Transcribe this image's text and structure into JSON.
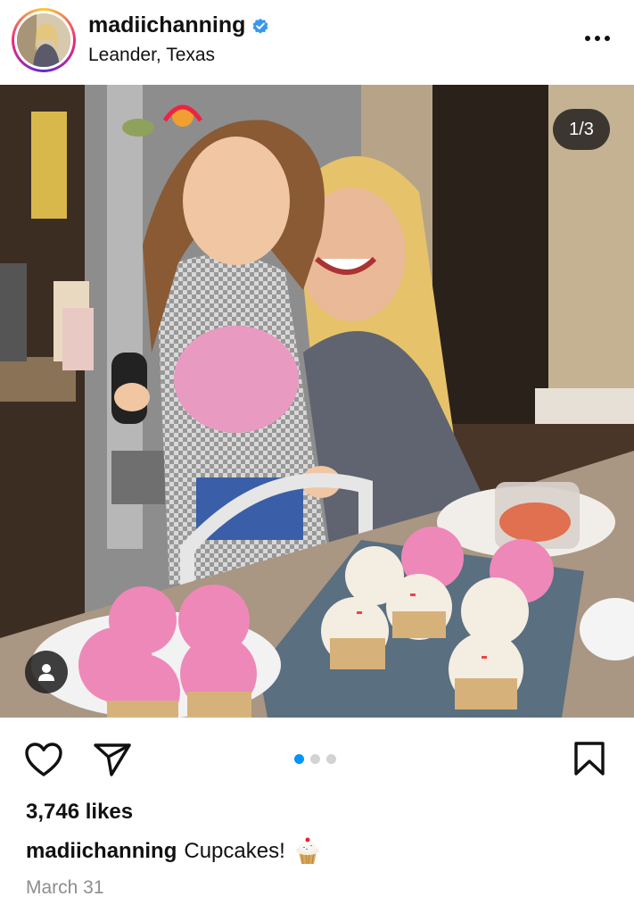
{
  "post": {
    "username": "madiichanning",
    "location": "Leander, Texas",
    "verified": true,
    "media_counter": "1/3",
    "carousel": {
      "current": 1,
      "total": 3
    },
    "likes": "3,746 likes",
    "caption_user": "madiichanning",
    "caption_text": "Cupcakes!",
    "caption_emoji": "cupcake-emoji",
    "date": "March 31"
  },
  "icons": {
    "more": "more-options-icon",
    "like": "heart-icon",
    "share": "paper-plane-icon",
    "save": "bookmark-icon",
    "tag": "person-tag-icon",
    "verified": "verified-badge-icon"
  },
  "colors": {
    "verified_blue": "#3897f0",
    "active_dot": "#0095f6",
    "inactive_dot": "#d3d3d3",
    "muted_text": "#8e8e8e"
  }
}
